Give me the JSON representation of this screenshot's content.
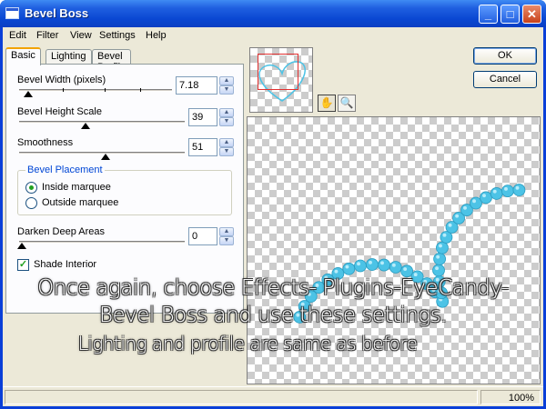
{
  "window": {
    "title": "Bevel Boss"
  },
  "titlebar_buttons": {
    "minimize": "_",
    "maximize": "□",
    "close": "✕"
  },
  "menu": [
    "Edit",
    "Filter",
    "View",
    "Settings",
    "Help"
  ],
  "tabs": [
    "Basic",
    "Lighting",
    "Bevel Profile"
  ],
  "basic": {
    "bevel_width": {
      "label": "Bevel Width (pixels)",
      "value": "7.18",
      "level": 0.05
    },
    "bevel_height": {
      "label": "Bevel Height Scale",
      "value": "39",
      "level": 0.39
    },
    "smoothness": {
      "label": "Smoothness",
      "value": "51",
      "level": 0.51
    },
    "placement": {
      "title": "Bevel Placement",
      "options": [
        "Inside marquee",
        "Outside marquee"
      ],
      "selected": 0
    },
    "darken": {
      "label": "Darken Deep Areas",
      "value": "0",
      "level": 0.0
    },
    "shade_interior": {
      "label": "Shade Interior",
      "checked": true
    }
  },
  "buttons": {
    "ok": "OK",
    "cancel": "Cancel"
  },
  "tools": {
    "hand": "✋",
    "zoom": "🔍"
  },
  "status": {
    "zoom": "100%"
  },
  "overlay": {
    "line1": "Once again, choose Effects- Plugins-EyeCandy-",
    "line2": "Bevel Boss and use these settings.",
    "line3": "Lighting and profile are same as before"
  },
  "colors": {
    "bead": "#4cc3e6",
    "titlebar": "#0a47d2",
    "selection_rect": "#e03030"
  },
  "icons": [
    "app-icon",
    "minimize-icon",
    "maximize-icon",
    "close-icon",
    "hand-tool-icon",
    "zoom-tool-icon",
    "spin-up-icon",
    "spin-down-icon"
  ]
}
